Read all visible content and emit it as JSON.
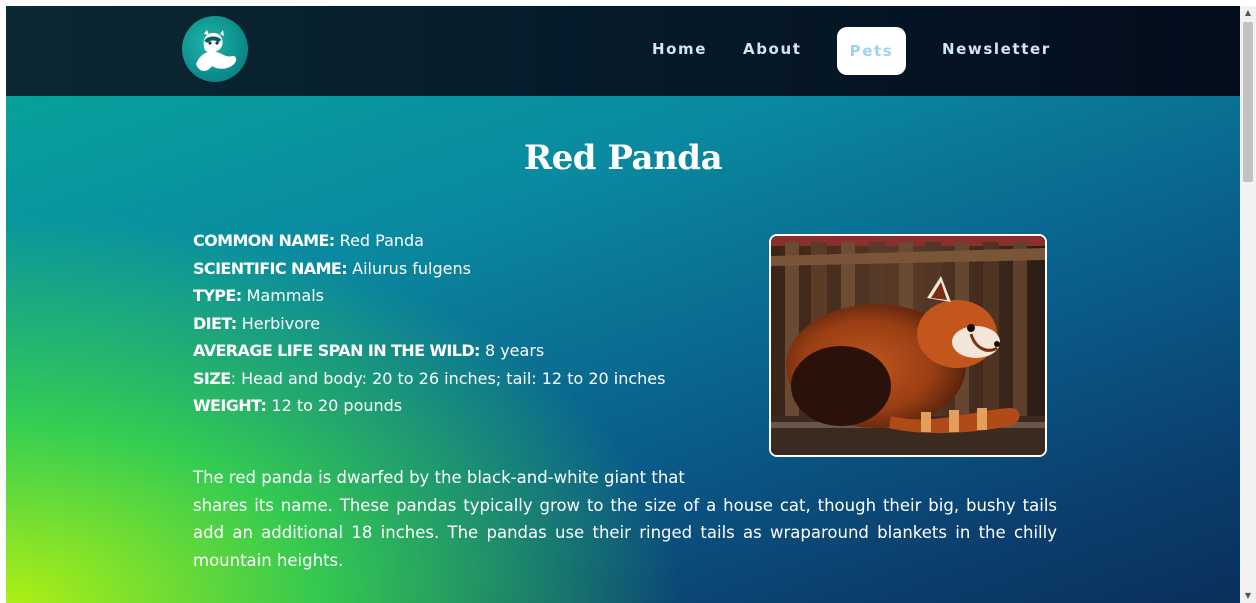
{
  "nav": {
    "items": [
      {
        "label": "Home"
      },
      {
        "label": "About"
      },
      {
        "label": "Pets",
        "active": true
      },
      {
        "label": "Newsletter"
      }
    ]
  },
  "page": {
    "title": "Red Panda"
  },
  "facts": [
    {
      "label": "COMMON NAME:",
      "value": " Red Panda"
    },
    {
      "label": "SCIENTIFIC NAME:",
      "value": " Ailurus fulgens"
    },
    {
      "label": "TYPE:",
      "value": " Mammals"
    },
    {
      "label": "DIET:",
      "value": " Herbivore"
    },
    {
      "label": "AVERAGE LIFE SPAN IN THE WILD:",
      "value": " 8 years"
    },
    {
      "label": "SIZE",
      "value": ": Head and body: 20 to 26 inches; tail: 12 to 20 inches"
    },
    {
      "label": "WEIGHT:",
      "value": " 12 to 20 pounds"
    }
  ],
  "description": {
    "line1": "The red panda is dwarfed by the black-and-white giant that",
    "rest": "shares its name. These pandas typically grow to the size of a house cat, though their big, bushy tails add an additional 18 inches. The pandas use their ringed tails as wraparound blankets in the chilly mountain heights."
  },
  "scrollbar": {
    "up_glyph": "▲",
    "down_glyph": "▼"
  },
  "colors": {
    "nav_active_bg": "#ffffff",
    "nav_text": "#cfe6f4",
    "nav_active_text": "#9fd4e8"
  },
  "icons": {
    "logo": "ferret-logo-icon"
  }
}
